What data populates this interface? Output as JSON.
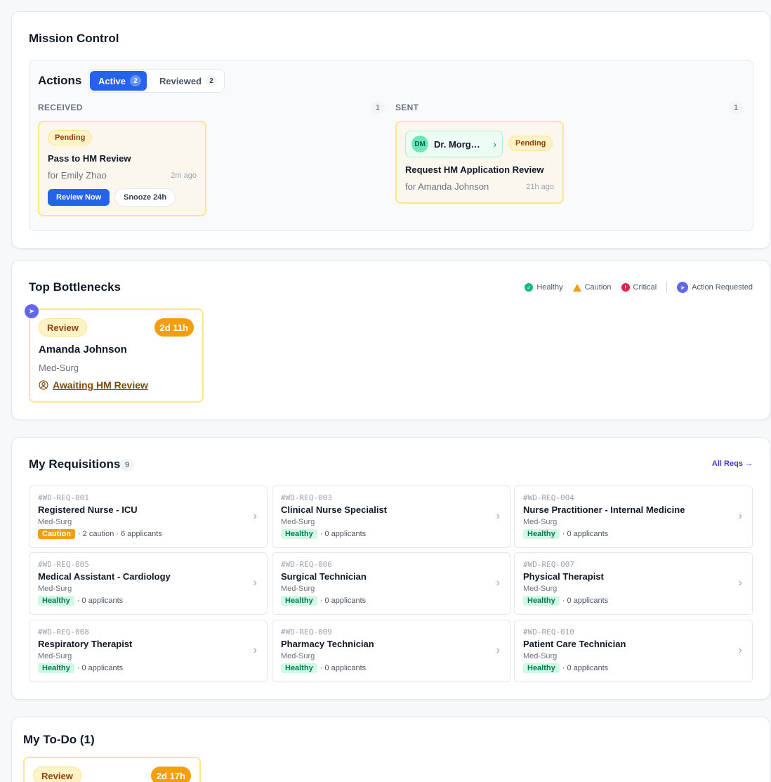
{
  "mission_control": {
    "title": "Mission Control",
    "actions": {
      "title": "Actions",
      "tabs": [
        {
          "label": "Active",
          "count": "2"
        },
        {
          "label": "Reviewed",
          "count": "2"
        }
      ],
      "received": {
        "label": "RECEIVED",
        "count": "1",
        "card": {
          "status": "Pending",
          "title": "Pass to HM Review",
          "for": "for Emily Zhao",
          "time": "2m ago",
          "primary_button": "Review Now",
          "secondary_button": "Snooze 24h"
        }
      },
      "sent": {
        "label": "SENT",
        "count": "1",
        "card": {
          "avatar": "DM",
          "person": "Dr. Morg…",
          "status": "Pending",
          "title": "Request HM Application Review",
          "for": "for Amanda Johnson",
          "time": "21h ago"
        }
      }
    }
  },
  "bottlenecks": {
    "title": "Top Bottlenecks",
    "legend": [
      "Healthy",
      "Caution",
      "Critical",
      "Action Requested"
    ],
    "legend_colors": {
      "healthy": "#10b981",
      "caution": "#f59e0b",
      "critical": "#e11d48",
      "action": "#6366f1"
    },
    "card": {
      "stage": "Review",
      "duration": "2d 11h",
      "name": "Amanda Johnson",
      "dept": "Med-Surg",
      "status": "Awaiting HM Review"
    }
  },
  "requisitions": {
    "title": "My Requisitions",
    "count": "9",
    "all_link": "All Reqs →",
    "items": [
      {
        "id": "#WD-REQ-001",
        "title": "Registered Nurse - ICU",
        "dept": "Med-Surg",
        "status": "Caution",
        "meta": "· 2 caution · 6 applicants"
      },
      {
        "id": "#WD-REQ-003",
        "title": "Clinical Nurse Specialist",
        "dept": "Med-Surg",
        "status": "Healthy",
        "meta": "· 0 applicants"
      },
      {
        "id": "#WD-REQ-004",
        "title": "Nurse Practitioner - Internal Medicine",
        "dept": "Med-Surg",
        "status": "Healthy",
        "meta": "· 0 applicants"
      },
      {
        "id": "#WD-REQ-005",
        "title": "Medical Assistant - Cardiology",
        "dept": "Med-Surg",
        "status": "Healthy",
        "meta": "· 0 applicants"
      },
      {
        "id": "#WD-REQ-006",
        "title": "Surgical Technician",
        "dept": "Med-Surg",
        "status": "Healthy",
        "meta": "· 0 applicants"
      },
      {
        "id": "#WD-REQ-007",
        "title": "Physical Therapist",
        "dept": "Med-Surg",
        "status": "Healthy",
        "meta": "· 0 applicants"
      },
      {
        "id": "#WD-REQ-008",
        "title": "Respiratory Therapist",
        "dept": "Med-Surg",
        "status": "Healthy",
        "meta": "· 0 applicants"
      },
      {
        "id": "#WD-REQ-009",
        "title": "Pharmacy Technician",
        "dept": "Med-Surg",
        "status": "Healthy",
        "meta": "· 0 applicants"
      },
      {
        "id": "#WD-REQ-010",
        "title": "Patient Care Technician",
        "dept": "Med-Surg",
        "status": "Healthy",
        "meta": "· 0 applicants"
      }
    ]
  },
  "todo": {
    "title": "My To-Do (1)",
    "card": {
      "stage": "Review",
      "duration": "2d 17h"
    }
  }
}
